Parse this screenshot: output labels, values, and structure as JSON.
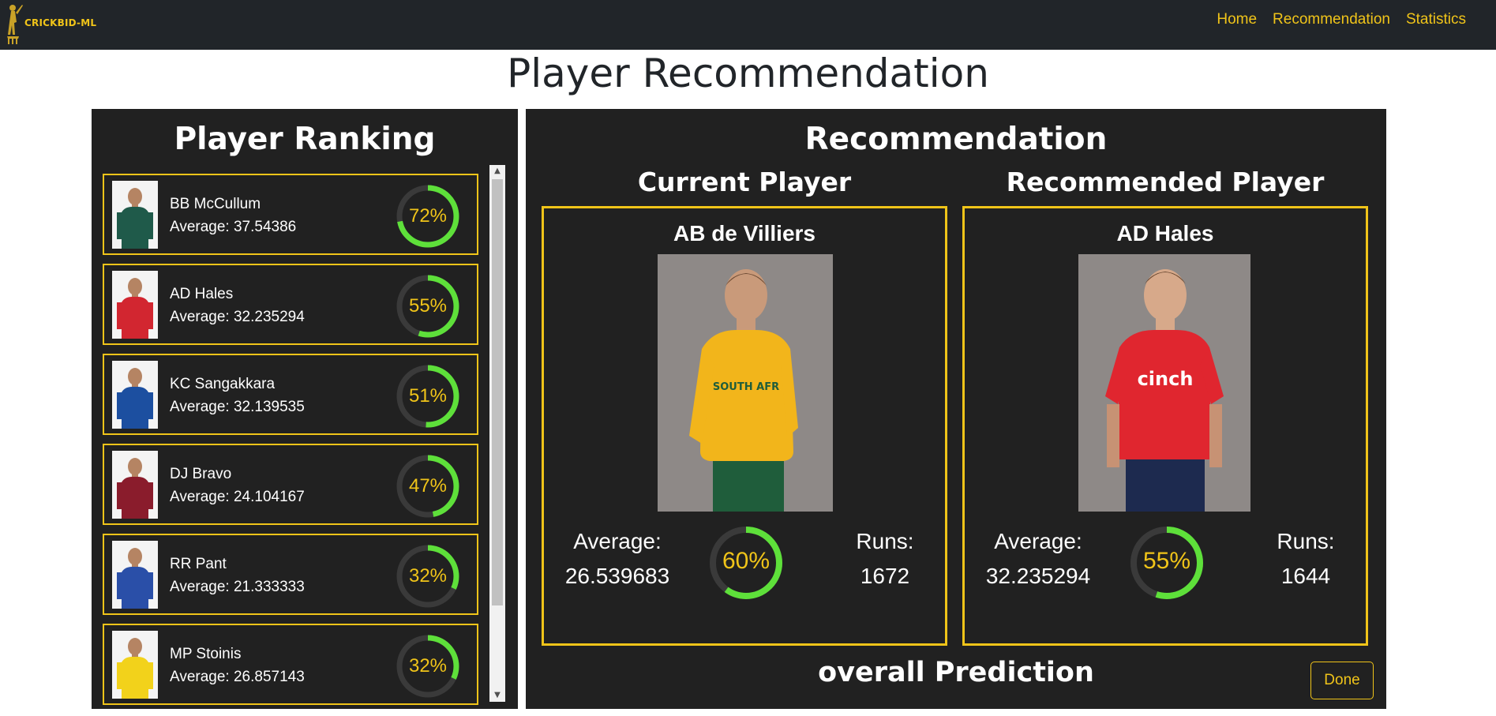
{
  "navbar": {
    "brand": "CRICKBID-ML",
    "links": [
      "Home",
      "Recommendation",
      "Statistics"
    ]
  },
  "page_title": "Player Recommendation",
  "ranking": {
    "heading": "Player Ranking",
    "players": [
      {
        "name": "BB McCullum",
        "average": "Average: 37.54386",
        "percent_label": "72%",
        "percent": 72,
        "jersey": "#1f5a4a"
      },
      {
        "name": "AD Hales",
        "average": "Average: 32.235294",
        "percent_label": "55%",
        "percent": 55,
        "jersey": "#d22630"
      },
      {
        "name": "KC Sangakkara",
        "average": "Average: 32.139535",
        "percent_label": "51%",
        "percent": 51,
        "jersey": "#1c4fa0"
      },
      {
        "name": "DJ Bravo",
        "average": "Average: 24.104167",
        "percent_label": "47%",
        "percent": 47,
        "jersey": "#8a1c2c"
      },
      {
        "name": "RR Pant",
        "average": "Average: 21.333333",
        "percent_label": "32%",
        "percent": 32,
        "jersey": "#2a4fa8"
      },
      {
        "name": "MP Stoinis",
        "average": "Average: 26.857143",
        "percent_label": "32%",
        "percent": 32,
        "jersey": "#f2d21b"
      }
    ]
  },
  "recommendation": {
    "heading": "Recommendation",
    "current": {
      "column_title": "Current Player",
      "name": "AB de Villiers",
      "average_label": "Average:",
      "average_value": "26.539683",
      "percent_label": "60%",
      "percent": 60,
      "runs_label": "Runs:",
      "runs_value": "1672",
      "jersey": "#f2b51b",
      "jersey_text": "SOUTH AFR"
    },
    "recommended": {
      "column_title": "Recommended Player",
      "name": "AD Hales",
      "average_label": "Average:",
      "average_value": "32.235294",
      "percent_label": "55%",
      "percent": 55,
      "runs_label": "Runs:",
      "runs_value": "1644",
      "jersey": "#e0262f",
      "jersey_text": "cinch"
    },
    "overall_label": "overall Prediction",
    "done_label": "Done"
  },
  "colors": {
    "accent": "#f0c419",
    "ring_progress": "#5ee03a",
    "ring_track": "#3a3a3a",
    "panel": "#212121",
    "navbar": "#212529"
  },
  "icons": {
    "brand_logo": "cricket-batsman-icon",
    "scroll_up": "scroll-up-arrow-icon",
    "scroll_down": "scroll-down-arrow-icon"
  }
}
